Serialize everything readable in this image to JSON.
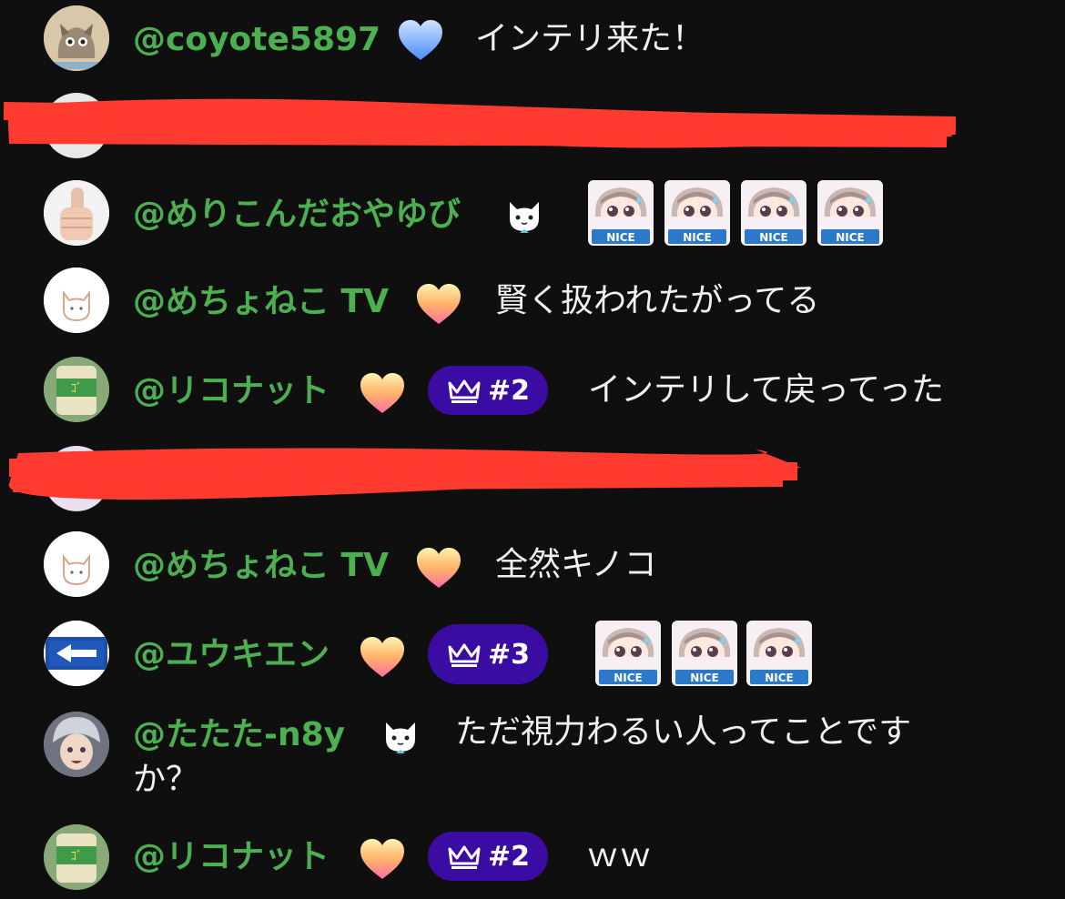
{
  "chat": {
    "messages": [
      {
        "username": "@coyote5897",
        "text": "インテリ来た！",
        "badge": "blue-heart-icon"
      },
      {
        "redacted": true
      },
      {
        "username": "@めりこんだおやゆび",
        "text": "",
        "badge": "cat-icon",
        "stickers": [
          "NICE",
          "NICE",
          "NICE",
          "NICE"
        ]
      },
      {
        "username": "@めちょねこ TV",
        "text": "賢く扱われたがってる",
        "badge": "gold-heart-icon"
      },
      {
        "username": "@リコナット",
        "text": "インテリして戻ってった",
        "badge": "gold-heart-icon",
        "rank": "#2"
      },
      {
        "redacted": true
      },
      {
        "username": "@めちょねこ TV",
        "text": "全然キノコ",
        "badge": "gold-heart-icon"
      },
      {
        "username": "@ユウキエン",
        "text": "",
        "badge": "gold-heart-icon",
        "rank": "#3",
        "stickers": [
          "NICE",
          "NICE",
          "NICE"
        ]
      },
      {
        "username": "@たたた-n8y",
        "text_line1": "ただ視力わるい人ってことです",
        "text_line2": "か？",
        "badge": "cat-icon"
      },
      {
        "username": "@リコナット",
        "text": "ｗｗ",
        "badge": "gold-heart-icon",
        "rank": "#2"
      }
    ]
  },
  "colors": {
    "background": "#0f0f0f",
    "username": "#4caf50",
    "message_text": "#f1f1f1",
    "rank_badge": "#3a0ca3",
    "redaction": "#ff3b30"
  }
}
